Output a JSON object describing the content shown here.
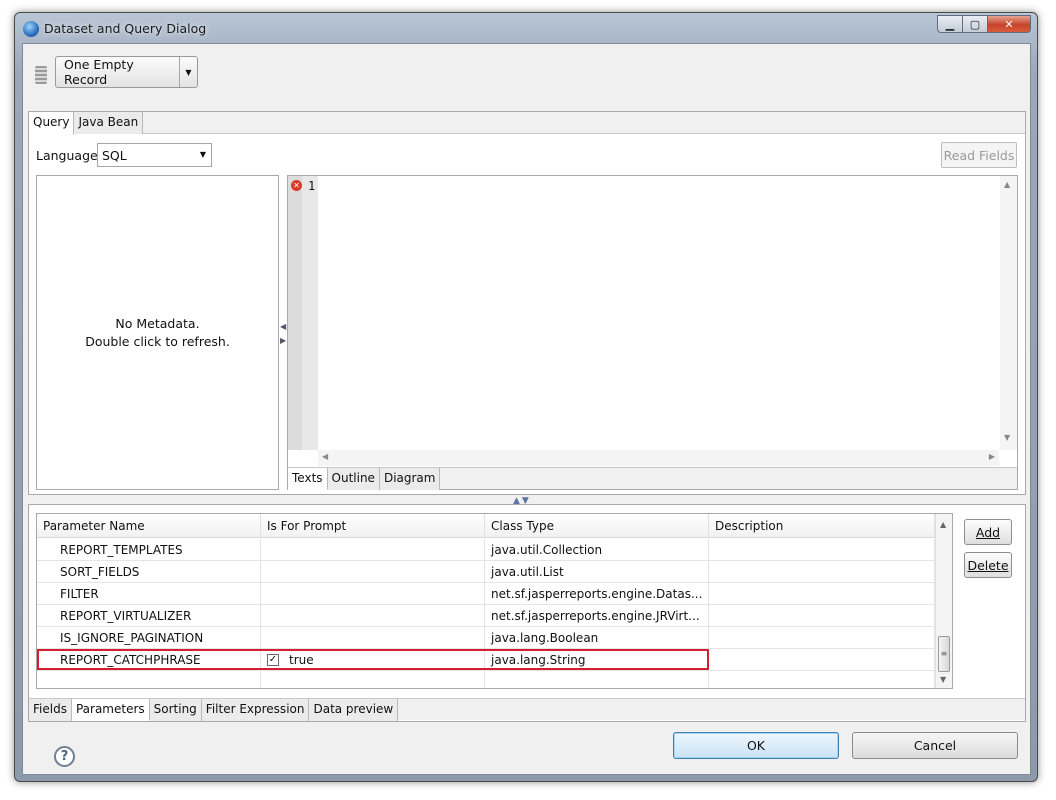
{
  "window": {
    "title": "Dataset and Query Dialog",
    "controls": {
      "minimize": "▁",
      "maximize": "▢",
      "close": "✕"
    }
  },
  "toolbar": {
    "combo_label": "One Empty Record",
    "combo_arrow": "▼"
  },
  "query": {
    "tabs": [
      "Query",
      "Java Bean"
    ],
    "language_label": "Language",
    "language_value": "SQL",
    "select_arrow": "▼",
    "read_fields_label": "Read Fields",
    "metadata_line1": "No Metadata.",
    "metadata_line2": "Double click to refresh.",
    "editor_line_number": "1",
    "error_glyph": "✕",
    "editor_tabs": [
      "Texts",
      "Outline",
      "Diagram"
    ]
  },
  "parameters": {
    "columns": [
      "Parameter Name",
      "Is For Prompt",
      "Class Type",
      "Description"
    ],
    "rows": [
      {
        "name": "REPORT_TEMPLATES",
        "prompt": "",
        "checked": false,
        "class_type": "java.util.Collection",
        "description": ""
      },
      {
        "name": "SORT_FIELDS",
        "prompt": "",
        "checked": false,
        "class_type": "java.util.List",
        "description": ""
      },
      {
        "name": "FILTER",
        "prompt": "",
        "checked": false,
        "class_type": "net.sf.jasperreports.engine.Datas...",
        "description": ""
      },
      {
        "name": "REPORT_VIRTUALIZER",
        "prompt": "",
        "checked": false,
        "class_type": "net.sf.jasperreports.engine.JRVirt...",
        "description": ""
      },
      {
        "name": "IS_IGNORE_PAGINATION",
        "prompt": "",
        "checked": false,
        "class_type": "java.lang.Boolean",
        "description": ""
      },
      {
        "name": "REPORT_CATCHPHRASE",
        "prompt": "true",
        "checked": true,
        "class_type": "java.lang.String",
        "description": ""
      }
    ],
    "add_label": "Add",
    "delete_label": "Delete",
    "bottom_tabs": [
      "Fields",
      "Parameters",
      "Sorting",
      "Filter Expression",
      "Data preview"
    ]
  },
  "footer": {
    "help": "?",
    "ok_label": "OK",
    "cancel_label": "Cancel"
  },
  "colors": {
    "highlight": "#d32030",
    "ok_border": "#3c7fb1"
  }
}
